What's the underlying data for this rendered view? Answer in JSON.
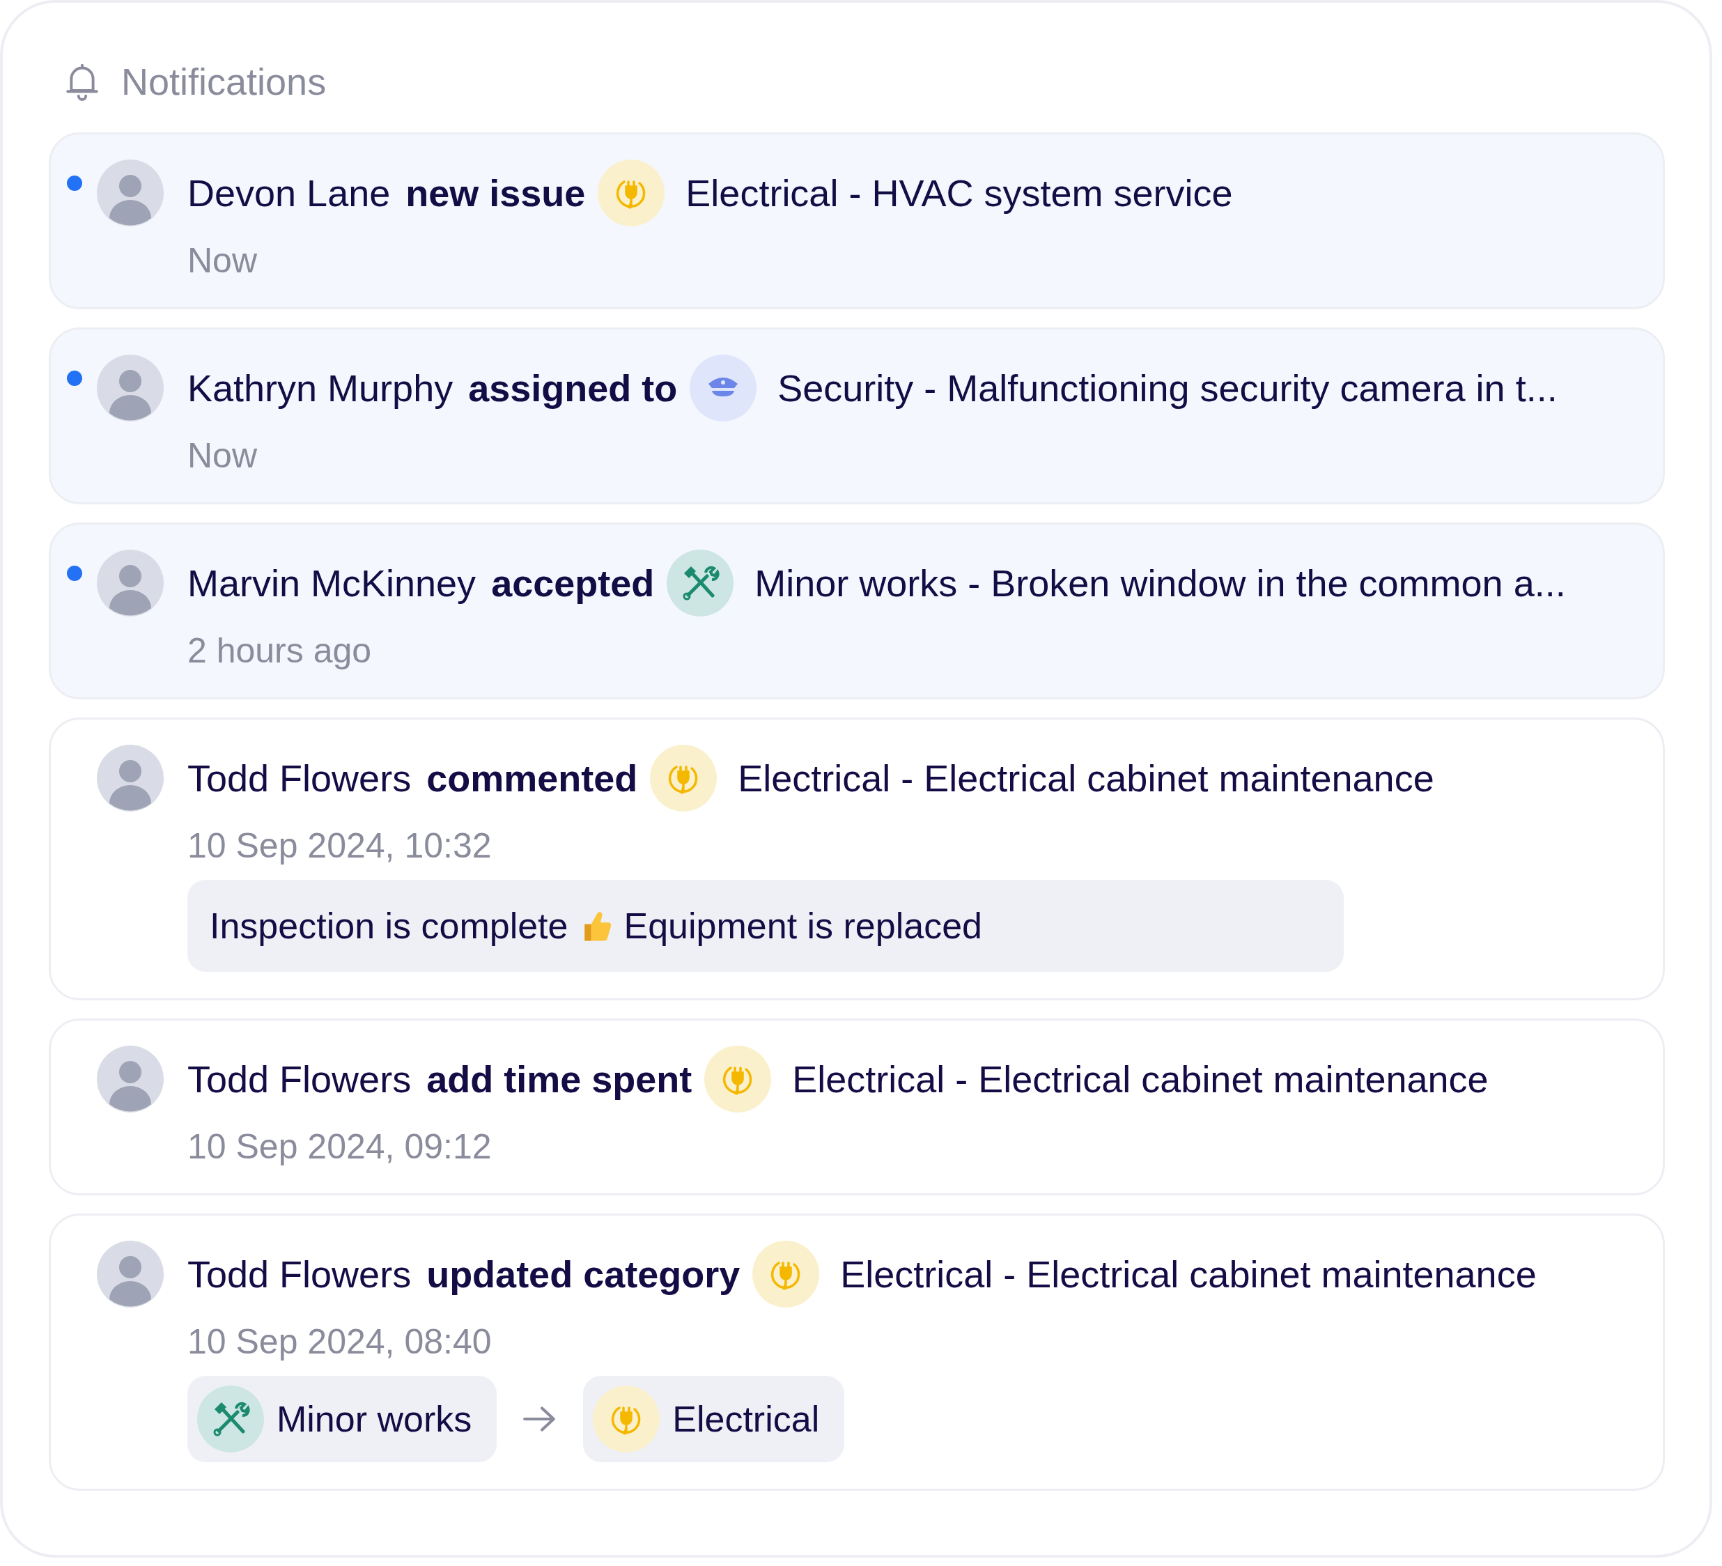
{
  "header": {
    "title": "Notifications"
  },
  "notifications": [
    {
      "unread": true,
      "name": "Devon Lane",
      "action": "new issue",
      "kind": "electrical",
      "subject": "Electrical - HVAC system service",
      "time": "Now"
    },
    {
      "unread": true,
      "name": "Kathryn Murphy",
      "action": "assigned to",
      "kind": "security",
      "subject": "Security - Malfunctioning security camera in t...",
      "time": "Now"
    },
    {
      "unread": true,
      "name": "Marvin McKinney",
      "action": "accepted",
      "kind": "minor_works",
      "subject": "Minor works - Broken window in the common a...",
      "time": "2 hours ago"
    },
    {
      "unread": false,
      "name": "Todd Flowers",
      "action": "commented",
      "kind": "electrical",
      "subject": "Electrical - Electrical cabinet maintenance",
      "time": "10 Sep 2024, 10:32",
      "comment": {
        "before": "Inspection is complete",
        "after": "Equipment is replaced"
      }
    },
    {
      "unread": false,
      "name": "Todd Flowers",
      "action": "add time spent",
      "kind": "electrical",
      "subject": "Electrical - Electrical cabinet maintenance",
      "time": "10 Sep 2024, 09:12"
    },
    {
      "unread": false,
      "name": "Todd Flowers",
      "action": "updated category",
      "kind": "electrical",
      "subject": "Electrical - Electrical cabinet maintenance",
      "time": "10 Sep 2024, 08:40",
      "change": {
        "from": {
          "kind": "minor_works",
          "label": "Minor works"
        },
        "to": {
          "kind": "electrical",
          "label": "Electrical"
        }
      }
    }
  ]
}
